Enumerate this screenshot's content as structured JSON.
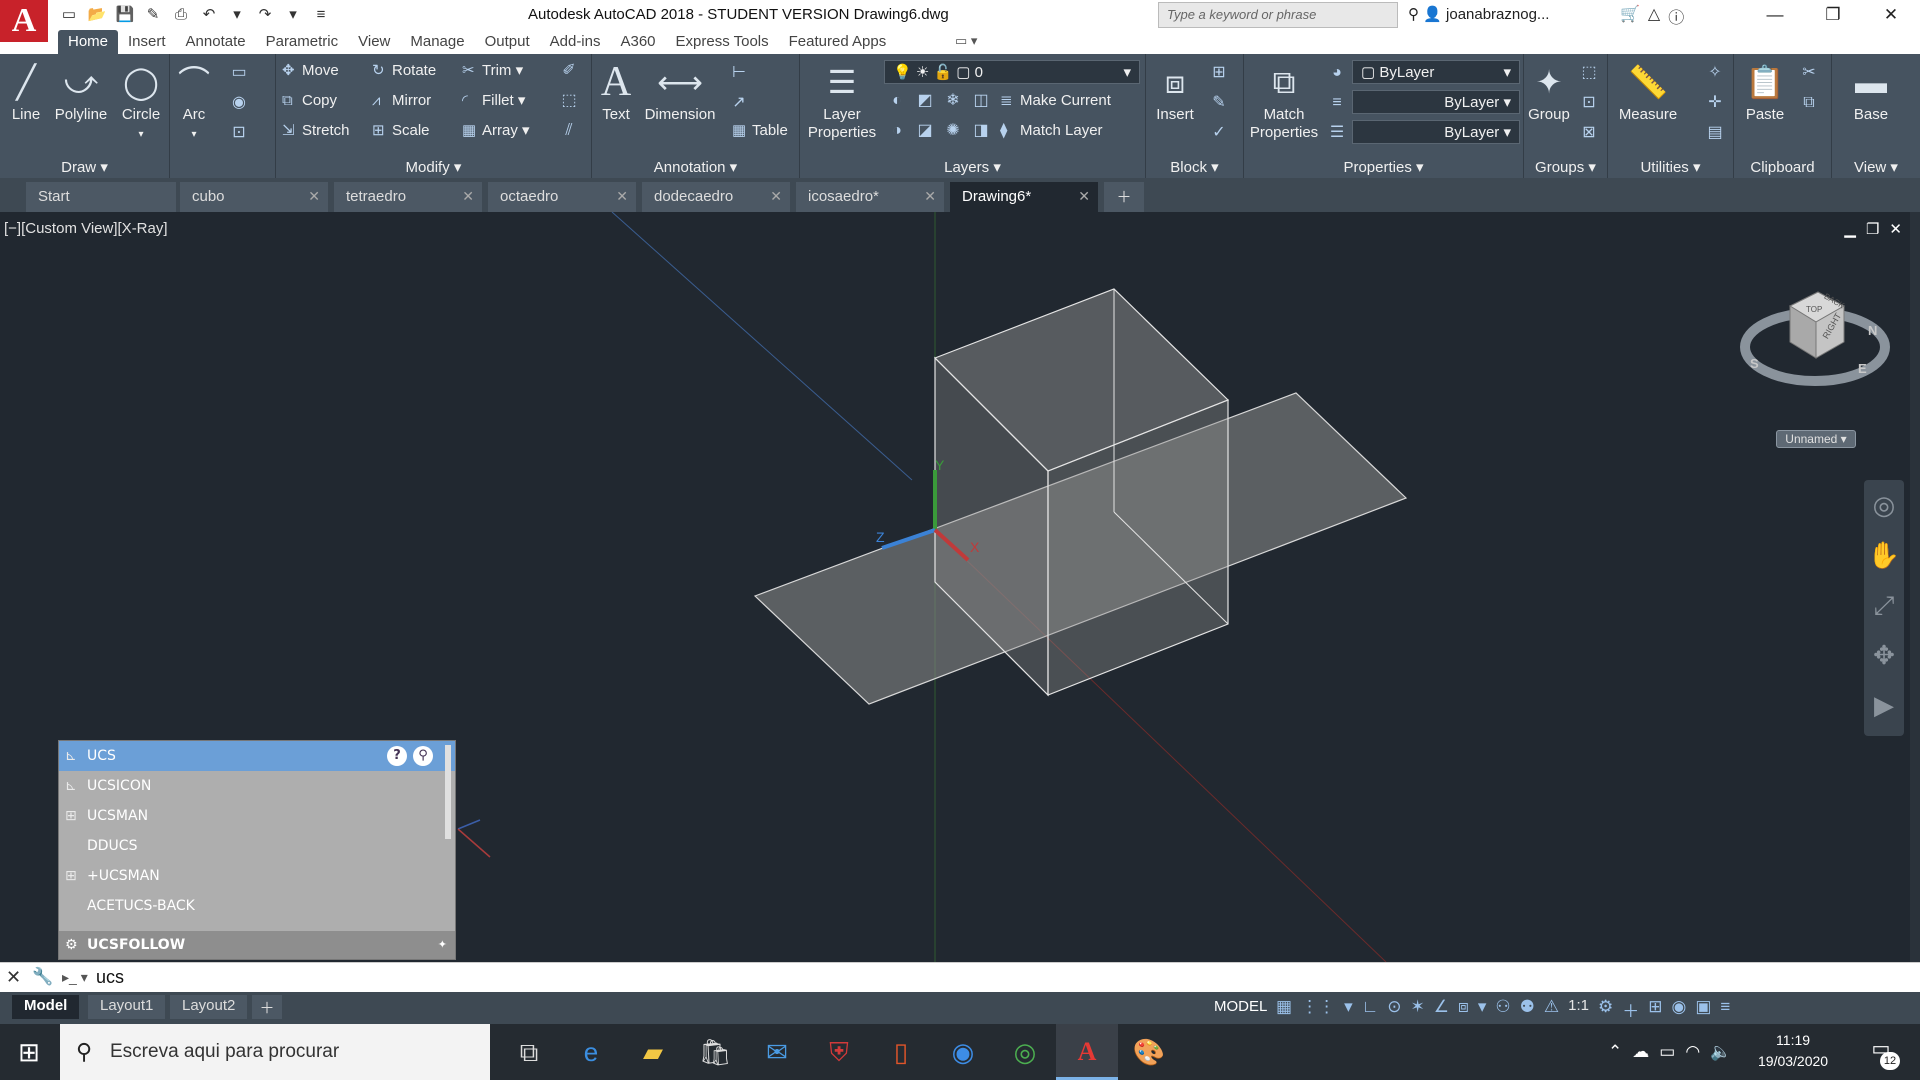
{
  "titlebar": {
    "app_letter": "A",
    "title": "Autodesk AutoCAD 2018 - STUDENT VERSION    Drawing6.dwg",
    "search_placeholder": "Type a keyword or phrase",
    "user": "joanabraznog..."
  },
  "ribbon_tabs": [
    "Home",
    "Insert",
    "Annotate",
    "Parametric",
    "View",
    "Manage",
    "Output",
    "Add-ins",
    "A360",
    "Express Tools",
    "Featured Apps"
  ],
  "ribbon": {
    "draw": {
      "title": "Draw",
      "line": "Line",
      "polyline": "Polyline",
      "circle": "Circle",
      "arc": "Arc"
    },
    "modify": {
      "title": "Modify",
      "move": "Move",
      "rotate": "Rotate",
      "trim": "Trim",
      "copy": "Copy",
      "mirror": "Mirror",
      "fillet": "Fillet",
      "stretch": "Stretch",
      "scale": "Scale",
      "array": "Array"
    },
    "annotation": {
      "title": "Annotation",
      "text": "Text",
      "dimension": "Dimension",
      "table": "Table"
    },
    "layers": {
      "title": "Layers",
      "layer_properties_1": "Layer",
      "layer_properties_2": "Properties",
      "current_layer": "0",
      "make_current": "Make Current",
      "match_layer": "Match Layer"
    },
    "block": {
      "title": "Block",
      "insert": "Insert"
    },
    "properties": {
      "title": "Properties",
      "match_1": "Match",
      "match_2": "Properties",
      "color": "ByLayer",
      "linetype": "ByLayer",
      "lineweight": "ByLayer"
    },
    "groups": {
      "title": "Groups",
      "group": "Group"
    },
    "utilities": {
      "title": "Utilities",
      "measure": "Measure"
    },
    "clipboard": {
      "title": "Clipboard",
      "paste": "Paste"
    },
    "view": {
      "title": "View",
      "base": "Base"
    }
  },
  "file_tabs": [
    "Start",
    "cubo",
    "tetraedro",
    "octaedro",
    "dodecaedro",
    "icosaedro*",
    "Drawing6*"
  ],
  "viewport": {
    "label": "[−][Custom View][X-Ray]",
    "axis_labels": {
      "y": "Y",
      "z": "Z",
      "x": "X"
    },
    "viewcube": {
      "top": "TOP",
      "right": "RIGHT",
      "back": "BACK",
      "n": "N",
      "e": "E",
      "s": "S"
    },
    "ucs_name": "Unnamed"
  },
  "autocomplete": {
    "items": [
      "UCS",
      "UCSICON",
      "UCSMAN",
      "DDUCS",
      "+UCSMAN",
      "ACETUCS-BACK"
    ],
    "footer": "UCSFOLLOW"
  },
  "command": {
    "input": "ucs"
  },
  "layout_tabs": [
    "Model",
    "Layout1",
    "Layout2"
  ],
  "status": {
    "model": "MODEL",
    "scale": "1:1"
  },
  "taskbar": {
    "search_placeholder": "Escreva aqui para procurar",
    "time": "11:19",
    "date": "19/03/2020",
    "notifications": "12"
  },
  "colors": {
    "ribbon": "#465360",
    "canvas": "#212830",
    "accent": "#6b9fd7"
  }
}
